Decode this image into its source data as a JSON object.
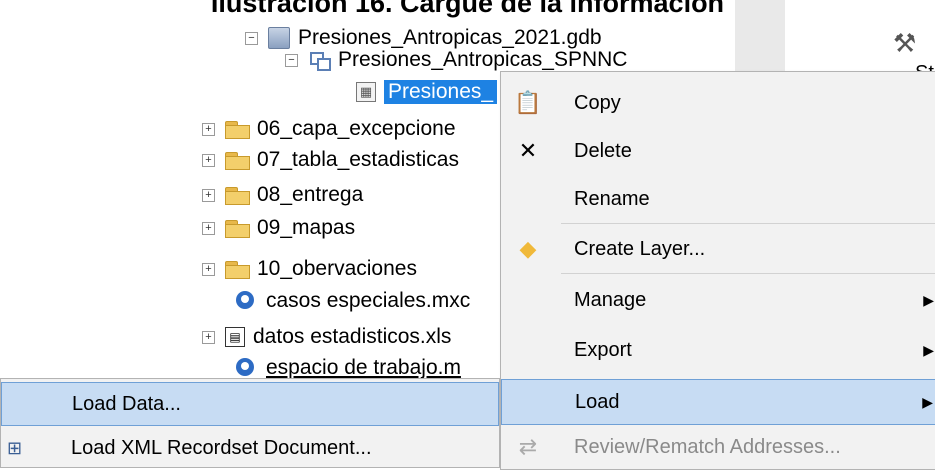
{
  "caption": "Ilustración 16. Cargue de la información",
  "tree": {
    "gdb": "Presiones_Antropicas_2021.gdb",
    "dataset": "Presiones_Antropicas_SPNNC",
    "selected": "Presiones_",
    "folders": [
      "06_capa_excepcione",
      "07_tabla_estadisticas",
      "08_entrega",
      "09_mapas",
      "10_obervaciones"
    ],
    "files": [
      "casos especiales.mxc",
      "datos estadisticos.xls",
      "espacio de trabajo.m"
    ]
  },
  "right_panel": {
    "partial_label": "St"
  },
  "context_menu": {
    "copy": "Copy",
    "delete": "Delete",
    "rename": "Rename",
    "create_layer": "Create Layer...",
    "manage": "Manage",
    "export": "Export",
    "load": "Load",
    "review": "Review/Rematch Addresses..."
  },
  "submenu": {
    "load_data": "Load Data...",
    "load_xml": "Load XML Recordset Document..."
  },
  "icons": {
    "expander_plus": "⊞",
    "expander_minus": "⊟",
    "copy_icon": "copy-icon",
    "delete_icon": "x-icon",
    "create_layer_icon": "diamond-icon"
  }
}
